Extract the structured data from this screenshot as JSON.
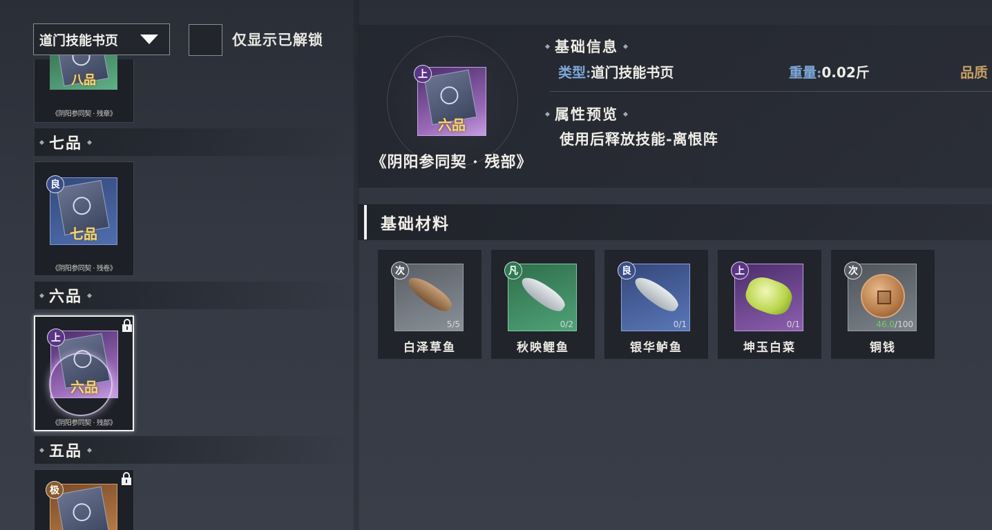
{
  "filter": {
    "dropdown_value": "道门技能书页",
    "only_unlocked_label": "仅显示已解锁"
  },
  "list": {
    "top_partial_card": {
      "grade": "八品",
      "caption": "《阴阳参同契 · 残章》"
    },
    "tiers": [
      {
        "name": "七品",
        "card": {
          "badge": "良",
          "grade": "七品",
          "caption": "《阴阳参同契 · 残卷》",
          "locked": false,
          "selected": false
        }
      },
      {
        "name": "六品",
        "card": {
          "badge": "上",
          "grade": "六品",
          "caption": "《阴阳参同契 · 残部》",
          "locked": true,
          "selected": true
        }
      },
      {
        "name": "五品",
        "card": {
          "badge": "极",
          "grade": "",
          "caption": "",
          "locked": true,
          "selected": false
        }
      }
    ]
  },
  "detail": {
    "badge": "上",
    "grade": "六品",
    "title": "《阴阳参同契 · 残部》",
    "basic_info_header": "基础信息",
    "type_label": "类型:",
    "type_value": "道门技能书页",
    "weight_label": "重量:",
    "weight_value": "0.02斤",
    "quality_label": "品质",
    "attr_header": "属性预览",
    "effect": "使用后释放技能-离恨阵"
  },
  "materials": {
    "header": "基础材料",
    "items": [
      {
        "badge": "次",
        "name": "白泽草鱼",
        "count_have": "",
        "count_text": "5/5"
      },
      {
        "badge": "凡",
        "name": "秋映鲤鱼",
        "count_have": "",
        "count_text": "0/2"
      },
      {
        "badge": "良",
        "name": "银华鲈鱼",
        "count_have": "",
        "count_text": "0/1"
      },
      {
        "badge": "上",
        "name": "坤玉白菜",
        "count_have": "",
        "count_text": "0/1"
      },
      {
        "badge": "次",
        "name": "铜钱",
        "count_have": "46.0",
        "count_text": "/100"
      }
    ]
  },
  "colors": {
    "background": "#2e323b",
    "label_blue": "#7fa7d8",
    "have_green": "#6fcf5f",
    "grade_gold": "#f3d87a"
  }
}
